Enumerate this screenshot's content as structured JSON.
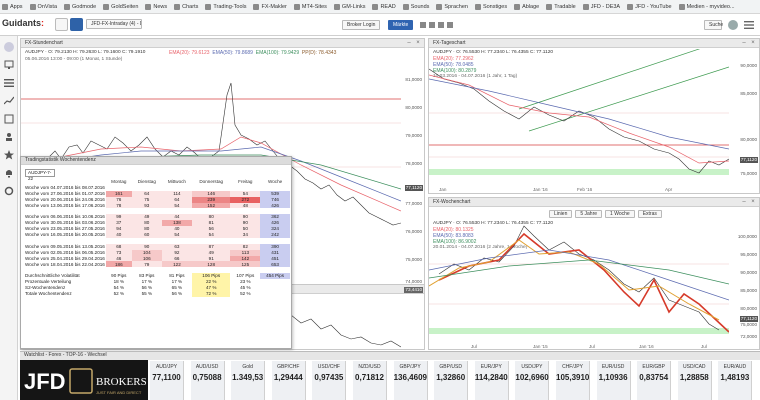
{
  "bookmarks": [
    {
      "label": "Apps"
    },
    {
      "label": "OnVista"
    },
    {
      "label": "Godmode"
    },
    {
      "label": "GoldSeiten"
    },
    {
      "label": "News"
    },
    {
      "label": "Charts"
    },
    {
      "label": "Trading-Tools"
    },
    {
      "label": "FX-Makler"
    },
    {
      "label": "MT4-Sites"
    },
    {
      "label": "GM-Links"
    },
    {
      "label": "READ"
    },
    {
      "label": "Sounds"
    },
    {
      "label": "Sprachen"
    },
    {
      "label": "Sonstiges"
    },
    {
      "label": "Ablage"
    },
    {
      "label": "Tradable"
    },
    {
      "label": "JFD - DE3A"
    },
    {
      "label": "JFD - YouTube"
    },
    {
      "label": "Medien - myvideo..."
    }
  ],
  "app": {
    "logo_text": "Guidants",
    "workspace_tab": "JFD-FX-Intraday (4) - D-6",
    "header_buttons": {
      "broker": "Broker Login",
      "markets": "Märkte",
      "search": "Suche"
    }
  },
  "panel_top_left": {
    "title": "FX-Stundenchart",
    "ohlc": "AUDJPY · O: 79.2130  H: 79.2630  L: 79.1600  C: 79.1910",
    "info": "05.06.2016 13:00 - 09:00 (1 Monat, 1 Stunde)",
    "legend": [
      "EMA(20): 79.6123",
      "EMA(50): 79.8689",
      "EMA(100): 79.9429",
      "PP(D): 78.4343"
    ],
    "yaxis": [
      "81,0000",
      "80,0000",
      "79,0000",
      "78,0000",
      "77,0000",
      "76,0000",
      "75,0000",
      "74,0000"
    ],
    "pricetag": "77,1120"
  },
  "panel_top_right": {
    "title": "FX-Tageschart",
    "ohlc": "AUDJPY · O: 76.5530  H: 77.2340  L: 76.4355  C: 77.1120",
    "legend": [
      "EMA(20): 77.2962",
      "EMA(50): 78.0485",
      "EMA(100): 80.2879"
    ],
    "info": "10.03.2016 - 04.07.2016 (1 Jahr, 1 Tag)",
    "yaxis": [
      "90,0000",
      "85,0000",
      "80,0000",
      "75,0000"
    ],
    "pricetag": "77,1120",
    "xaxis": [
      "Jan",
      "Jan '16",
      "Feb '16",
      "Apr"
    ]
  },
  "panel_bottom_right": {
    "title": "FX-Wochenchart",
    "ohlc": "AUDJPY · O: 76.5530  H: 77.2340  L: 76.4355  C: 77.1120",
    "legend": [
      "EMA(20): 80.1325",
      "EMA(50): 83.8083",
      "EMA(100): 86.9002"
    ],
    "info": "20.01.2014 - 04.07.2016 (2 Jahre, 1 Woche)",
    "toolbar": [
      "Linien",
      "5 Jahre",
      "1 Woche",
      "Extras"
    ],
    "yaxis": [
      "100,0000",
      "95,0000",
      "90,0000",
      "85,0000",
      "80,0000",
      "75,0000",
      "72,0000"
    ],
    "pricetag": "77,1120",
    "xaxis": [
      "Jul",
      "Jan '15",
      "Jul",
      "Jan '16",
      "Jul"
    ]
  },
  "panel_mid_left": {
    "title": "FX-Wochenchart",
    "pricetag": "73,4410"
  },
  "stats": {
    "title": "Tradingstatistik Wochentendenz",
    "symbol": "AUDJPY-7-22",
    "headers": [
      "Montag",
      "Dienstag",
      "Mittwoch",
      "Donnerstag",
      "Freitag",
      "Woche"
    ],
    "rows": [
      {
        "label": "Woche vom 04.07.2016 bis 08.07.2016",
        "v": [
          "",
          "",
          "",
          "",
          "",
          ""
        ]
      },
      {
        "label": "Woche vom 27.06.2016 bis 01.07.2016",
        "v": [
          "161",
          "64",
          "114",
          "146",
          "54",
          "539"
        ]
      },
      {
        "label": "Woche vom 20.06.2016 bis 24.06.2016",
        "v": [
          "76",
          "75",
          "64",
          "239",
          "272",
          "746"
        ]
      },
      {
        "label": "Woche vom 13.06.2016 bis 17.06.2016",
        "v": [
          "78",
          "93",
          "54",
          "152",
          "48",
          "426"
        ]
      },
      {
        "label": "",
        "v": [
          "",
          "",
          "",
          "",
          "",
          ""
        ]
      },
      {
        "label": "Woche vom 06.06.2016 bis 10.06.2016",
        "v": [
          "99",
          "49",
          "44",
          "80",
          "90",
          "362"
        ]
      },
      {
        "label": "Woche vom 30.05.2016 bis 03.06.2016",
        "v": [
          "37",
          "80",
          "138",
          "81",
          "90",
          "426"
        ]
      },
      {
        "label": "Woche vom 23.05.2016 bis 27.05.2016",
        "v": [
          "94",
          "80",
          "40",
          "56",
          "50",
          "324"
        ]
      },
      {
        "label": "Woche vom 16.05.2016 bis 20.05.2016",
        "v": [
          "40",
          "60",
          "54",
          "54",
          "34",
          "242"
        ]
      },
      {
        "label": "",
        "v": [
          "",
          "",
          "",
          "",
          "",
          ""
        ]
      },
      {
        "label": "Woche vom 09.05.2016 bis 13.05.2016",
        "v": [
          "68",
          "90",
          "63",
          "87",
          "82",
          "390"
        ]
      },
      {
        "label": "Woche vom 02.05.2016 bis 06.05.2016",
        "v": [
          "73",
          "104",
          "92",
          "49",
          "113",
          "431"
        ]
      },
      {
        "label": "Woche vom 25.04.2016 bis 29.04.2016",
        "v": [
          "46",
          "106",
          "66",
          "91",
          "142",
          "451"
        ]
      },
      {
        "label": "Woche vom 18.04.2016 bis 22.04.2016",
        "v": [
          "186",
          "79",
          "122",
          "128",
          "125",
          "653"
        ]
      },
      {
        "label": "",
        "v": [
          "",
          "",
          "",
          "",
          "",
          ""
        ]
      },
      {
        "label": "Durchschnittliche Volatilität",
        "v": [
          "90 Pips",
          "83 Pips",
          "81 Pips",
          "106 Pips",
          "107 Pips",
          "454 Pips"
        ]
      },
      {
        "label": "Prozentuale Verteilung",
        "v": [
          "18 %",
          "17 %",
          "17 %",
          "22 %",
          "23 %",
          ""
        ]
      },
      {
        "label": "S2-Wochentendenz",
        "v": [
          "54 %",
          "56 %",
          "65 %",
          "47 %",
          "45 %",
          ""
        ]
      },
      {
        "label": "Totale Wochentendenz",
        "v": [
          "52 %",
          "55 %",
          "56 %",
          "72 %",
          "52 %",
          ""
        ]
      }
    ],
    "heat": [
      [
        0,
        0,
        0,
        0,
        0,
        0
      ],
      [
        3,
        1,
        1,
        2,
        1,
        1
      ],
      [
        1,
        1,
        1,
        4,
        5,
        1
      ],
      [
        1,
        1,
        1,
        3,
        1,
        1
      ],
      [
        0,
        0,
        0,
        0,
        0,
        0
      ],
      [
        1,
        1,
        1,
        1,
        1,
        1
      ],
      [
        1,
        1,
        3,
        1,
        1,
        1
      ],
      [
        1,
        1,
        1,
        1,
        1,
        1
      ],
      [
        1,
        1,
        1,
        1,
        1,
        1
      ],
      [
        0,
        0,
        0,
        0,
        0,
        0
      ],
      [
        1,
        1,
        1,
        1,
        1,
        1
      ],
      [
        1,
        2,
        1,
        1,
        2,
        1
      ],
      [
        1,
        2,
        1,
        1,
        3,
        1
      ],
      [
        3,
        1,
        2,
        2,
        2,
        2
      ]
    ]
  },
  "watchlist": {
    "title": "Watchlist - Forex - TOP-16 - Wechsel",
    "brand_line1": "JFD",
    "brand_line2": "BROKERS",
    "brand_tagline": "JUST FAIR AND DIRECT",
    "tiles": [
      {
        "sym": "AUD/JPY",
        "val": "77,1100"
      },
      {
        "sym": "AUD/USD",
        "val": "0,75088"
      },
      {
        "sym": "Gold",
        "val": "1.349,53"
      },
      {
        "sym": "GBP/CHF",
        "val": "1,29444"
      },
      {
        "sym": "USD/CHF",
        "val": "0,97435"
      },
      {
        "sym": "NZD/USD",
        "val": "0,71812"
      },
      {
        "sym": "GBP/JPY",
        "val": "136,4609"
      },
      {
        "sym": "GBP/USD",
        "val": "1,32860"
      },
      {
        "sym": "EUR/JPY",
        "val": "114,2840"
      },
      {
        "sym": "USD/JPY",
        "val": "102,6960"
      },
      {
        "sym": "CHF/JPY",
        "val": "105,3910"
      },
      {
        "sym": "EUR/USD",
        "val": "1,10936"
      },
      {
        "sym": "EUR/GBP",
        "val": "0,83754"
      },
      {
        "sym": "USD/CAD",
        "val": "1,28858"
      },
      {
        "sym": "EUR/AUD",
        "val": "1,48193"
      }
    ]
  }
}
